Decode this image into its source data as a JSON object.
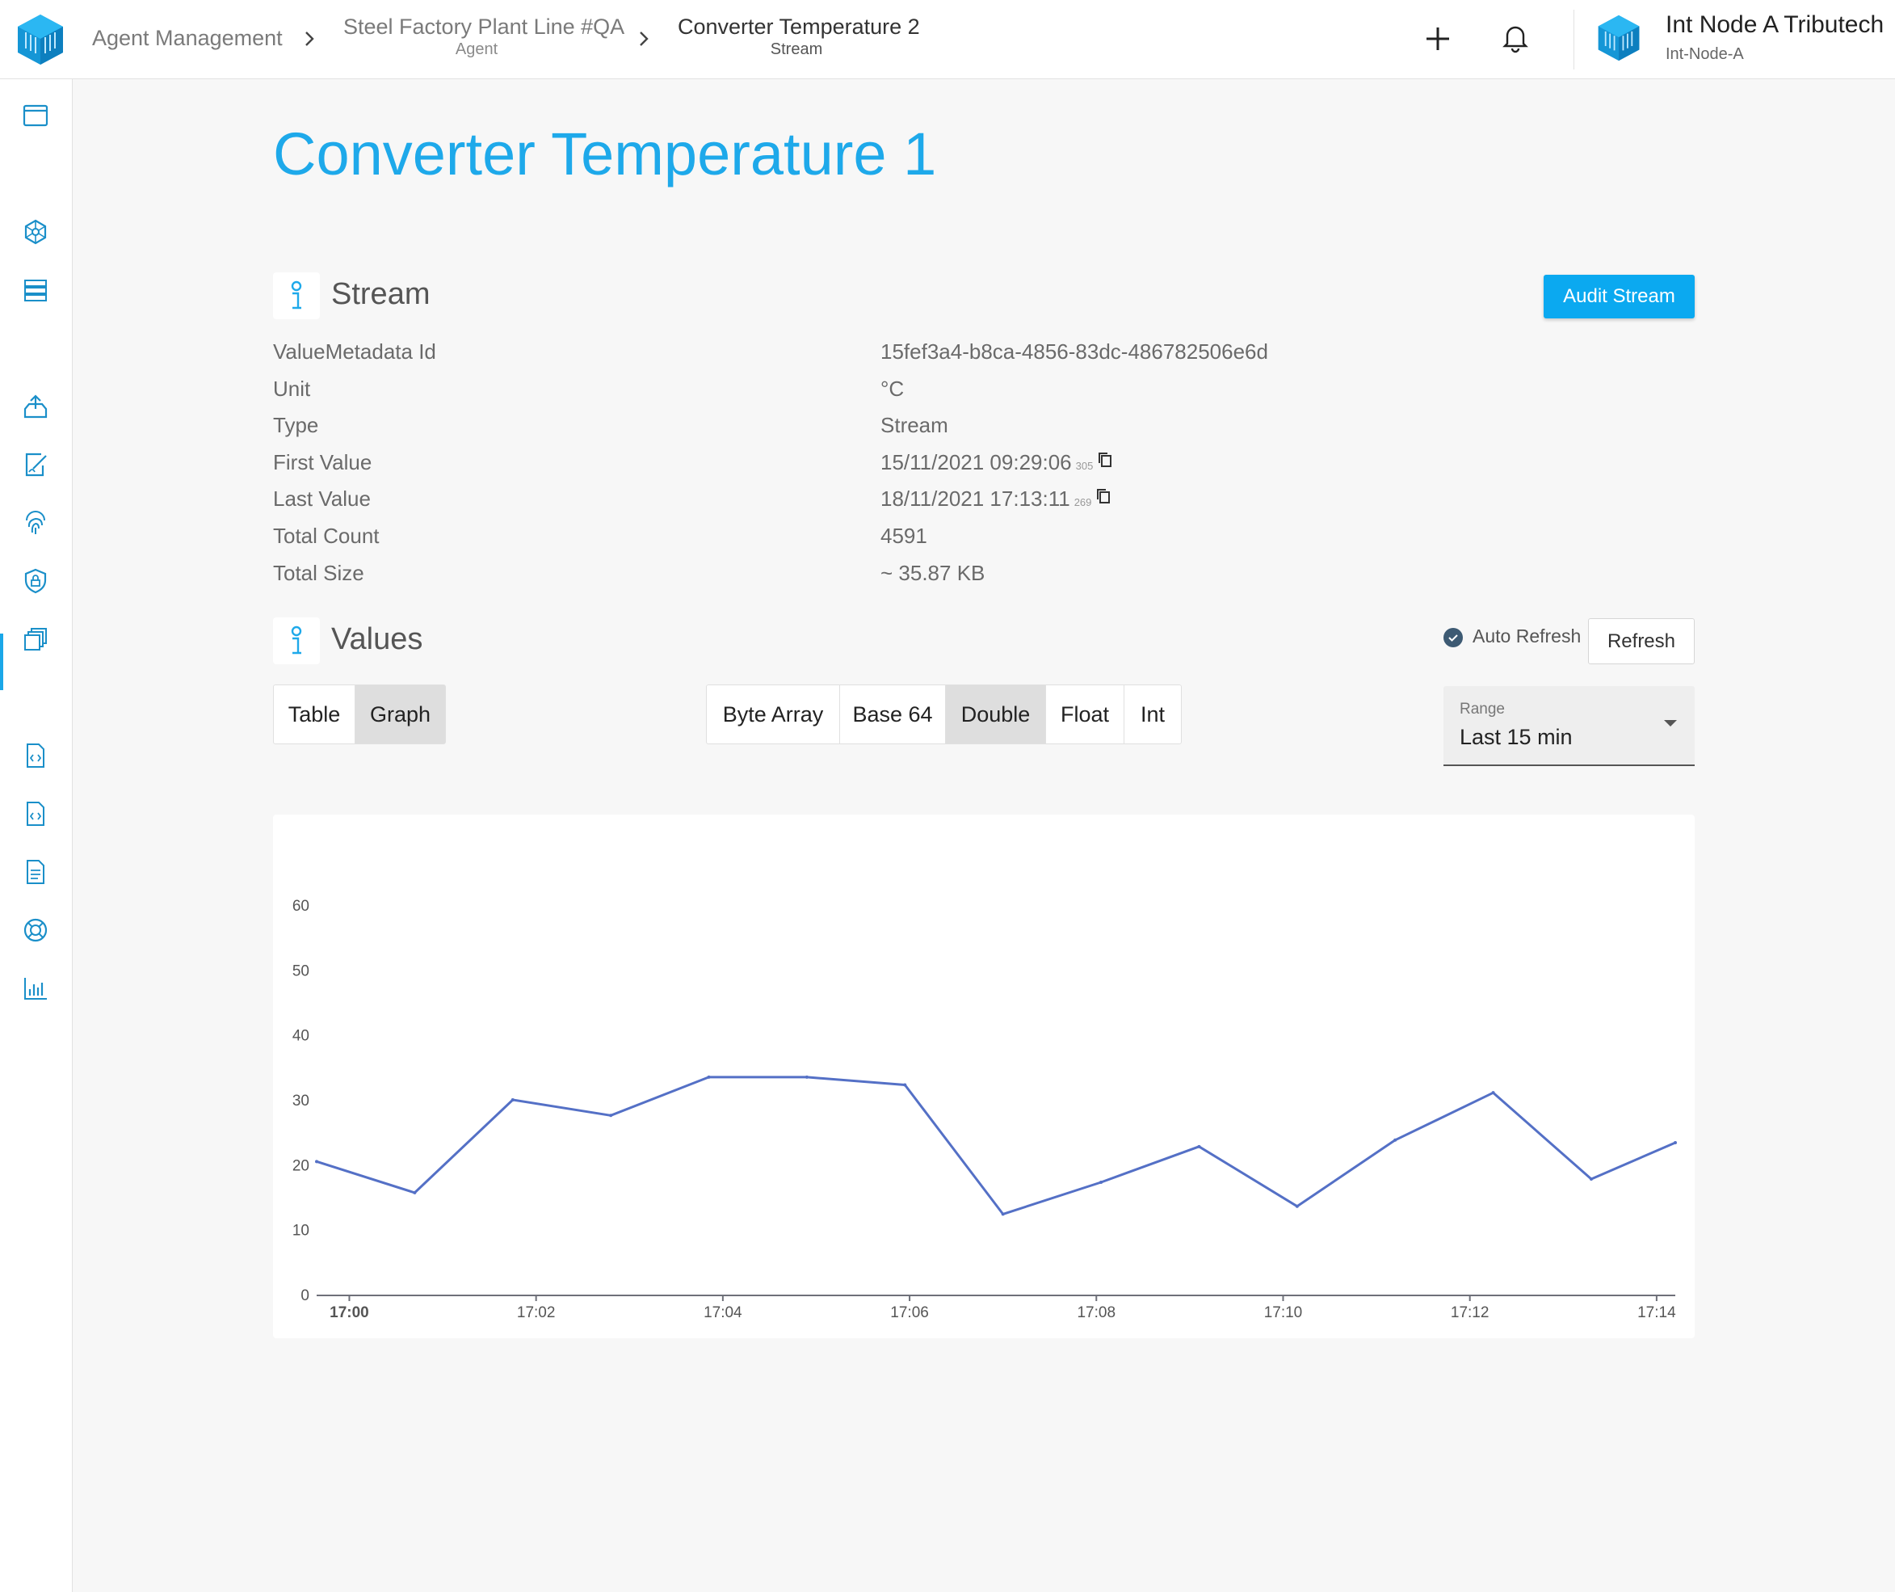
{
  "breadcrumb": [
    {
      "label": "Agent Management",
      "sub": ""
    },
    {
      "label": "Steel Factory Plant Line #QA",
      "sub": "Agent"
    },
    {
      "label": "Converter Temperature 2",
      "sub": "Stream"
    }
  ],
  "node": {
    "name": "Int Node A Tributech",
    "id": "Int-Node-A"
  },
  "page_title": "Converter Temperature 1",
  "stream_section": {
    "title": "Stream",
    "audit_button": "Audit Stream",
    "rows": [
      {
        "label": "ValueMetadata Id",
        "value": "15fef3a4-b8ca-4856-83dc-486782506e6d",
        "ms": ""
      },
      {
        "label": "Unit",
        "value": "°C",
        "ms": ""
      },
      {
        "label": "Type",
        "value": "Stream",
        "ms": ""
      },
      {
        "label": "First Value",
        "value": "15/11/2021 09:29:06",
        "ms": "305"
      },
      {
        "label": "Last Value",
        "value": "18/11/2021 17:13:11",
        "ms": "269"
      },
      {
        "label": "Total Count",
        "value": "4591",
        "ms": ""
      },
      {
        "label": "Total Size",
        "value": "~ 35.87 KB",
        "ms": ""
      }
    ]
  },
  "values_section": {
    "title": "Values",
    "auto_refresh_label": "Auto Refresh",
    "auto_refresh_checked": true,
    "refresh_button": "Refresh",
    "view_tabs": [
      {
        "label": "Table",
        "active": false
      },
      {
        "label": "Graph",
        "active": true
      }
    ],
    "format_tabs": [
      {
        "label": "Byte Array",
        "active": false
      },
      {
        "label": "Base 64",
        "active": false
      },
      {
        "label": "Double",
        "active": true
      },
      {
        "label": "Float",
        "active": false
      },
      {
        "label": "Int",
        "active": false
      }
    ],
    "range": {
      "label": "Range",
      "value": "Last 15 min"
    }
  },
  "colors": {
    "accent": "#1ea9ea",
    "button": "#0ba9f0",
    "line": "#5470c6"
  },
  "sidebar_icons": [
    "window-icon",
    "cube-network-icon",
    "server-icon",
    "upload-tray-icon",
    "sign-document-icon",
    "fingerprint-icon",
    "shield-lock-icon",
    "layers-icon",
    "code-file-icon",
    "code-file-icon",
    "document-icon",
    "lifebuoy-icon",
    "bar-chart-icon"
  ],
  "chart_data": {
    "type": "line",
    "x_tick_labels": [
      "17:00",
      "17:02",
      "17:04",
      "17:06",
      "17:08",
      "17:10",
      "17:12",
      "17:14"
    ],
    "y_tick_labels": [
      "0",
      "10",
      "20",
      "30",
      "40",
      "50",
      "60"
    ],
    "ylim": [
      0,
      60
    ],
    "xlim_minutes": [
      -0.35,
      14.2
    ],
    "x_minutes": [
      -0.35,
      0.7,
      1.75,
      2.8,
      3.85,
      4.9,
      5.95,
      7.0,
      8.05,
      9.1,
      10.15,
      11.2,
      12.25,
      13.3,
      14.2
    ],
    "values": [
      20.5,
      15.7,
      30.0,
      27.6,
      33.5,
      33.5,
      32.3,
      12.4,
      17.3,
      22.8,
      13.6,
      23.8,
      31.1,
      17.8,
      23.4
    ],
    "series_color": "#5470c6",
    "grid": false
  }
}
